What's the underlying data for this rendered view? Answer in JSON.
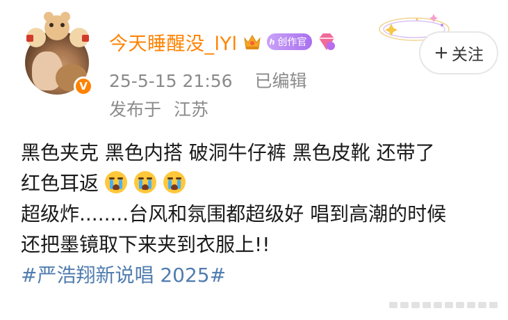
{
  "post": {
    "username": "今天睡醒没_lYl",
    "creator_badge": "创作官",
    "creator_badge_mini": "ℎ",
    "verified_mark": "V",
    "timestamp": "25-5-15 21:56",
    "edited_label": "已编辑",
    "location_prefix": "发布于",
    "location": "江苏",
    "follow_label": "关注",
    "follow_plus": "+",
    "content": {
      "line1": "黑色夹克 黑色内搭 破洞牛仔裤 黑色皮靴 还带了",
      "line2": "红色耳返",
      "line3": "超级炸........台风和氛围都超级好 唱到高潮的时候",
      "line4": "还把墨镜取下来夹到衣服上!!",
      "hashtag": "#严浩翔新说唱 2025#"
    },
    "emojis": [
      "crying-face",
      "crying-face",
      "crying-face"
    ]
  },
  "colors": {
    "username": "#ff8200",
    "meta": "#8a8a8a",
    "hashtag": "#507daf",
    "verified": "#ff8200"
  }
}
